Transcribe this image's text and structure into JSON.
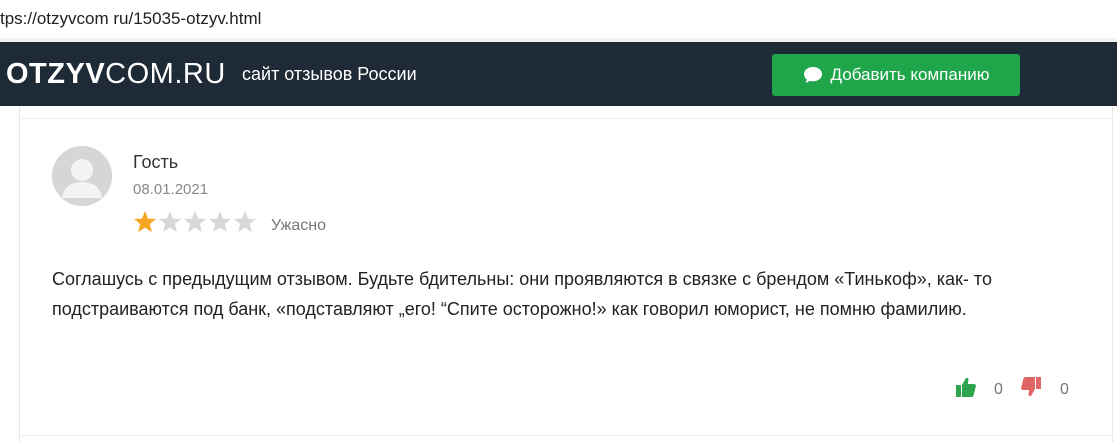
{
  "browser": {
    "url": "tps://otzyvcom ru/15035-otzyv.html"
  },
  "header": {
    "logo_bold": "OTZYV",
    "logo_thin": "COM.RU",
    "tagline": "сайт отзывов России",
    "add_company_label": "Добавить компанию",
    "accent_color": "#1fa64a",
    "bg_color": "#1f2a37"
  },
  "review": {
    "author": "Гость",
    "date": "08.01.2021",
    "rating": 1,
    "rating_max": 5,
    "rating_label": "Ужасно",
    "text": "Соглашусь с предыдущим отзывом. Будьте бдительны: они проявляются в связке с брендом «Тинькоф», как- то подстраиваются под банк, «подставляют „его! “Спите осторожно!» как говорил юморист, не помню фамилию.",
    "likes": "0",
    "dislikes": "0",
    "star_color": "#f5a623",
    "star_empty_color": "#d8d8d8",
    "like_color": "#2ea44f",
    "dislike_color": "#e06666"
  }
}
